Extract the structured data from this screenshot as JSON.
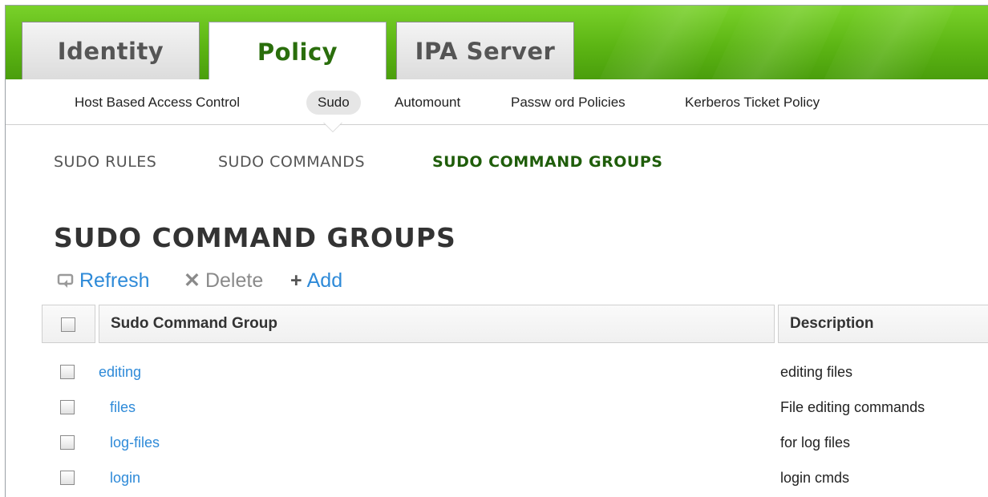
{
  "tabs": [
    {
      "label": "Identity",
      "active": false
    },
    {
      "label": "Policy",
      "active": true
    },
    {
      "label": "IPA Server",
      "active": false
    }
  ],
  "subnav": [
    {
      "label": "Host Based Access Control",
      "active": false
    },
    {
      "label": "Sudo",
      "active": true
    },
    {
      "label": "Automount",
      "active": false
    },
    {
      "label": "Passw ord Policies",
      "active": false
    },
    {
      "label": "Kerberos Ticket Policy",
      "active": false
    }
  ],
  "facets": [
    {
      "label": "SUDO RULES",
      "active": false
    },
    {
      "label": "SUDO COMMANDS",
      "active": false
    },
    {
      "label": "SUDO COMMAND GROUPS",
      "active": true
    }
  ],
  "page": {
    "title": "SUDO COMMAND GROUPS"
  },
  "actions": {
    "refresh": {
      "label": "Refresh",
      "icon": "refresh-icon",
      "enabled": true
    },
    "delete": {
      "label": "Delete",
      "icon": "close-icon",
      "enabled": false
    },
    "add": {
      "label": "Add",
      "icon": "plus-icon",
      "enabled": true
    }
  },
  "table": {
    "columns": [
      "Sudo Command Group",
      "Description"
    ],
    "rows": [
      {
        "name": "editing",
        "description": "editing files"
      },
      {
        "name": "files",
        "description": "File editing commands"
      },
      {
        "name": "log-files",
        "description": "for log files"
      },
      {
        "name": "login",
        "description": "login cmds"
      }
    ]
  },
  "colors": {
    "header_green": "#5cb514",
    "active_green": "#2a6e0c",
    "link_blue": "#2e8ad8"
  }
}
